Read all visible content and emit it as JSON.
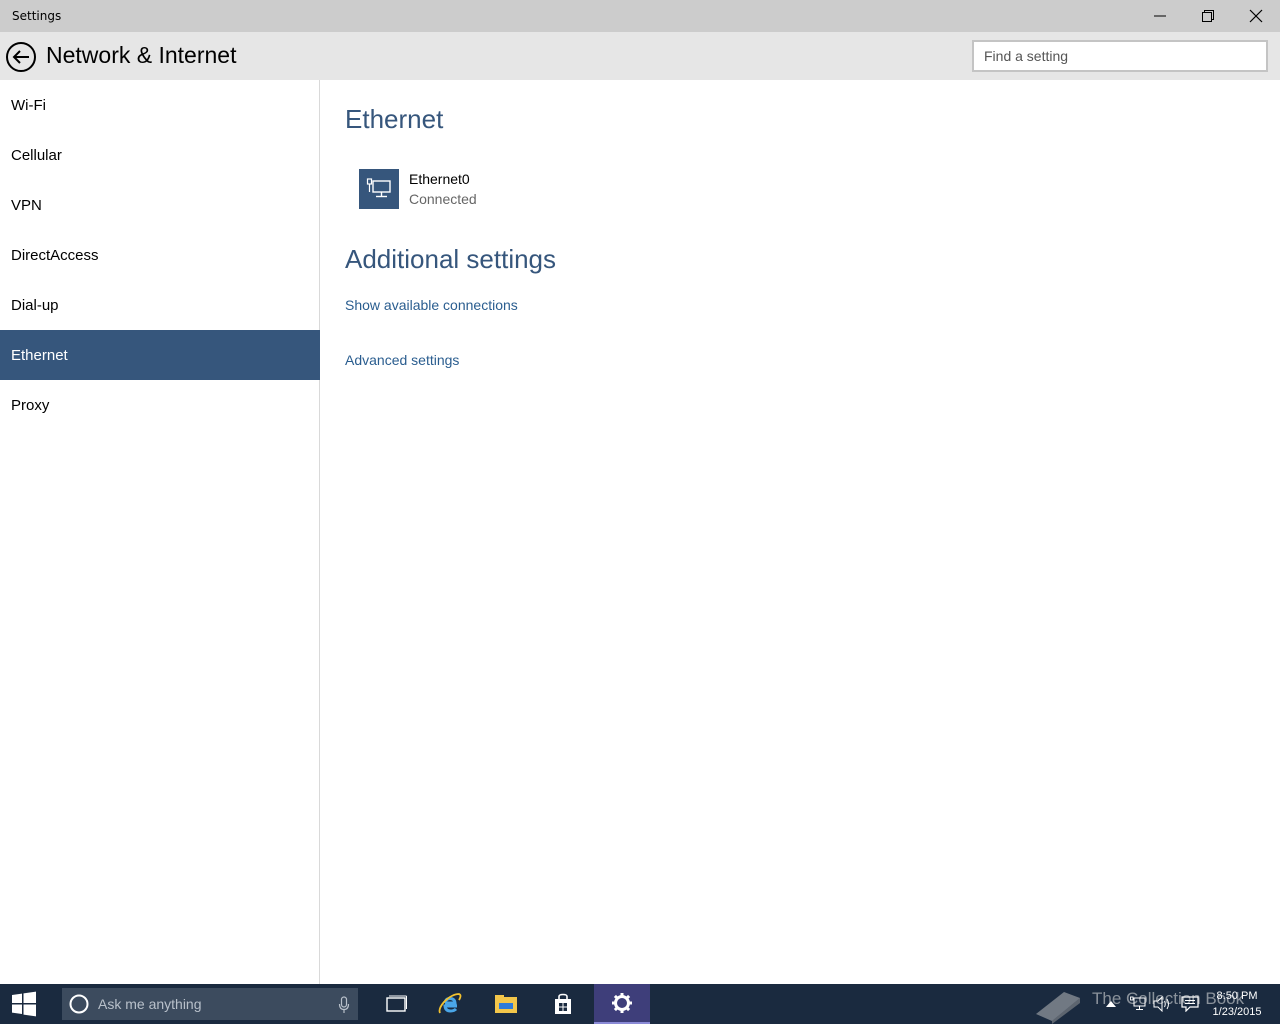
{
  "window": {
    "title": "Settings",
    "minimize_icon": "minimize-icon",
    "restore_icon": "restore-icon",
    "close_icon": "close-icon"
  },
  "header": {
    "title": "Network & Internet",
    "search_placeholder": "Find a setting"
  },
  "sidebar": {
    "items": [
      {
        "label": "Wi-Fi",
        "active": false
      },
      {
        "label": "Cellular",
        "active": false
      },
      {
        "label": "VPN",
        "active": false
      },
      {
        "label": "DirectAccess",
        "active": false
      },
      {
        "label": "Dial-up",
        "active": false
      },
      {
        "label": "Ethernet",
        "active": true
      },
      {
        "label": "Proxy",
        "active": false
      }
    ]
  },
  "main": {
    "section_title": "Ethernet",
    "connection": {
      "name": "Ethernet0",
      "status": "Connected"
    },
    "additional_title": "Additional settings",
    "links": [
      "Show available connections",
      "Advanced settings"
    ]
  },
  "taskbar": {
    "search_placeholder": "Ask me anything",
    "time": "8:50 PM",
    "date": "1/23/2015",
    "watermark": "The Collection Book"
  },
  "colors": {
    "accent": "#36567c",
    "link": "#2a5d8f",
    "taskbar": "#1a2a3f"
  }
}
